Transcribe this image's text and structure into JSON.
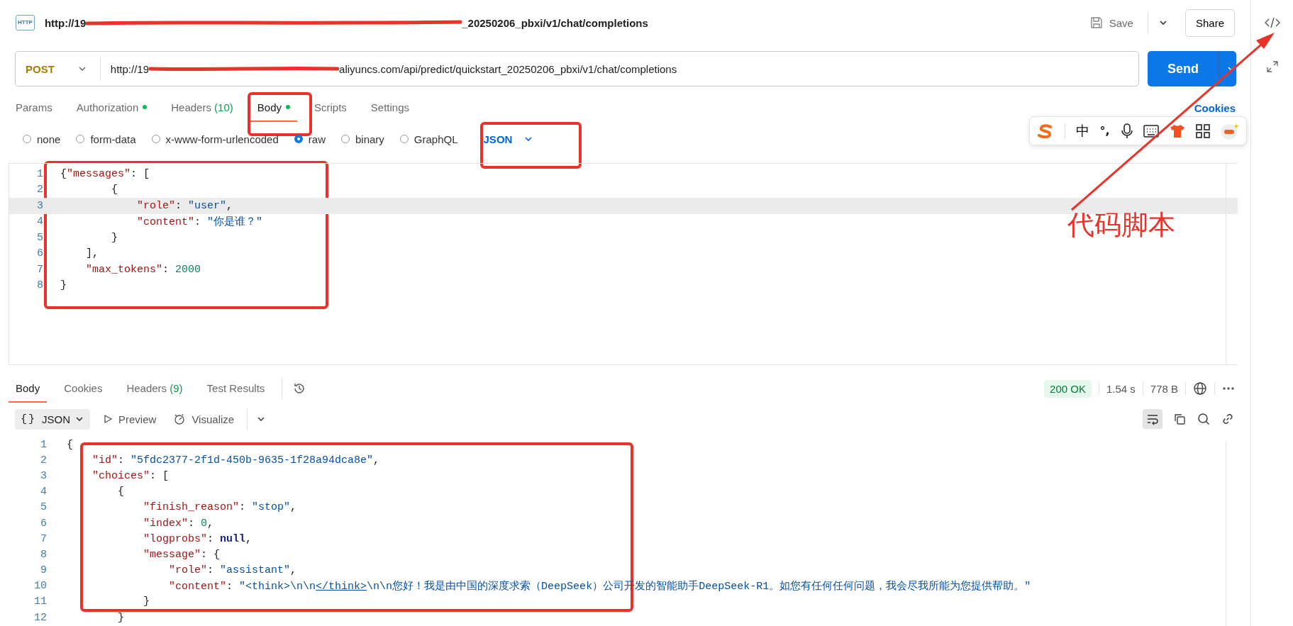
{
  "request": {
    "icon_label": "HTTP",
    "title_start": "http://19",
    "title_end": "_20250206_pbxi/v1/chat/completions",
    "save": "Save",
    "share": "Share",
    "method": "POST",
    "url_start": "http://19",
    "url_end": "aliyuncs.com/api/predict/quickstart_20250206_pbxi/v1/chat/completions",
    "send": "Send"
  },
  "tabs": [
    {
      "label": "Params",
      "dot": false,
      "selected": false
    },
    {
      "label": "Authorization",
      "dot": true,
      "selected": false
    },
    {
      "label": "Headers",
      "count": "(10)",
      "dot": false,
      "selected": false
    },
    {
      "label": "Body",
      "dot": true,
      "selected": true
    },
    {
      "label": "Scripts",
      "dot": false,
      "selected": false
    },
    {
      "label": "Settings",
      "dot": false,
      "selected": false
    }
  ],
  "cookies_link": "Cookies",
  "body_types": [
    {
      "label": "none",
      "selected": false
    },
    {
      "label": "form-data",
      "selected": false
    },
    {
      "label": "x-www-form-urlencoded",
      "selected": false
    },
    {
      "label": "raw",
      "selected": true
    },
    {
      "label": "binary",
      "selected": false
    },
    {
      "label": "GraphQL",
      "selected": false
    }
  ],
  "body_format": "JSON",
  "request_lines": [
    {
      "number": "1",
      "active": false,
      "tokens": [
        {
          "kind": "p",
          "text": "{"
        },
        {
          "kind": "k",
          "text": "\"messages\""
        },
        {
          "kind": "p",
          "text": ": ["
        }
      ]
    },
    {
      "number": "2",
      "active": false,
      "tokens": [
        {
          "kind": "p",
          "text": "        {"
        }
      ]
    },
    {
      "number": "3",
      "active": true,
      "tokens": [
        {
          "kind": "k",
          "text": "            \"role\""
        },
        {
          "kind": "p",
          "text": ": "
        },
        {
          "kind": "s",
          "text": "\"user\""
        },
        {
          "kind": "p",
          "text": ","
        }
      ]
    },
    {
      "number": "4",
      "active": false,
      "tokens": [
        {
          "kind": "k",
          "text": "            \"content\""
        },
        {
          "kind": "p",
          "text": ": "
        },
        {
          "kind": "s",
          "text": "\"你是谁？\""
        }
      ]
    },
    {
      "number": "5",
      "active": false,
      "tokens": [
        {
          "kind": "p",
          "text": "        }"
        }
      ]
    },
    {
      "number": "6",
      "active": false,
      "tokens": [
        {
          "kind": "p",
          "text": "    ],"
        }
      ]
    },
    {
      "number": "7",
      "active": false,
      "tokens": [
        {
          "kind": "k",
          "text": "    \"max_tokens\""
        },
        {
          "kind": "p",
          "text": ": "
        },
        {
          "kind": "n",
          "text": "2000"
        }
      ]
    },
    {
      "number": "8",
      "active": false,
      "tokens": [
        {
          "kind": "p",
          "text": "}"
        }
      ]
    }
  ],
  "response_tabs": [
    {
      "label": "Body",
      "selected": true
    },
    {
      "label": "Cookies",
      "selected": false
    },
    {
      "label": "Headers",
      "count": "(9)",
      "selected": false
    },
    {
      "label": "Test Results",
      "selected": false
    }
  ],
  "status": "200 OK",
  "time": "1.54 s",
  "size": "778 B",
  "view": {
    "format_icon": "{}",
    "format": "JSON",
    "preview": "Preview",
    "visualize": "Visualize",
    "wrap_on": true
  },
  "response_lines": [
    {
      "number": "1",
      "tokens": [
        {
          "kind": "p",
          "text": "{"
        }
      ]
    },
    {
      "number": "2",
      "tokens": [
        {
          "kind": "k",
          "text": "    \"id\""
        },
        {
          "kind": "p",
          "text": ": "
        },
        {
          "kind": "s",
          "text": "\"5fdc2377-2f1d-450b-9635-1f28a94dca8e\""
        },
        {
          "kind": "p",
          "text": ","
        }
      ]
    },
    {
      "number": "3",
      "tokens": [
        {
          "kind": "k",
          "text": "    \"choices\""
        },
        {
          "kind": "p",
          "text": ": ["
        }
      ]
    },
    {
      "number": "4",
      "tokens": [
        {
          "kind": "p",
          "text": "        {"
        }
      ]
    },
    {
      "number": "5",
      "tokens": [
        {
          "kind": "k",
          "text": "            \"finish_reason\""
        },
        {
          "kind": "p",
          "text": ": "
        },
        {
          "kind": "s",
          "text": "\"stop\""
        },
        {
          "kind": "p",
          "text": ","
        }
      ]
    },
    {
      "number": "6",
      "tokens": [
        {
          "kind": "k",
          "text": "            \"index\""
        },
        {
          "kind": "p",
          "text": ": "
        },
        {
          "kind": "n",
          "text": "0"
        },
        {
          "kind": "p",
          "text": ","
        }
      ]
    },
    {
      "number": "7",
      "tokens": [
        {
          "kind": "k",
          "text": "            \"logprobs\""
        },
        {
          "kind": "p",
          "text": ": "
        },
        {
          "kind": "kw",
          "text": "null"
        },
        {
          "kind": "p",
          "text": ","
        }
      ]
    },
    {
      "number": "8",
      "tokens": [
        {
          "kind": "k",
          "text": "            \"message\""
        },
        {
          "kind": "p",
          "text": ": {"
        }
      ]
    },
    {
      "number": "9",
      "tokens": [
        {
          "kind": "k",
          "text": "                \"role\""
        },
        {
          "kind": "p",
          "text": ": "
        },
        {
          "kind": "s",
          "text": "\"assistant\""
        },
        {
          "kind": "p",
          "text": ","
        }
      ]
    },
    {
      "number": "10",
      "tokens": [
        {
          "kind": "k",
          "text": "                \"content\""
        },
        {
          "kind": "p",
          "text": ": "
        },
        {
          "kind": "s",
          "text": "\"<think>\\n\\n"
        },
        {
          "kind": "lnk",
          "text": "</think>"
        },
        {
          "kind": "s",
          "text": "\\n\\n您好！我是由中国的深度求索（DeepSeek）公司开发的智能助手DeepSeek-R1。如您有任何任何问题，我会尽我所能为您提供帮助。\""
        }
      ]
    },
    {
      "number": "11",
      "tokens": [
        {
          "kind": "p",
          "text": "            }"
        }
      ]
    },
    {
      "number": "12",
      "tokens": [
        {
          "kind": "p",
          "text": "        }"
        }
      ]
    }
  ],
  "ime": {
    "mode": "中",
    "punct": "°,"
  },
  "annotation": {
    "label": "代码脚本"
  }
}
